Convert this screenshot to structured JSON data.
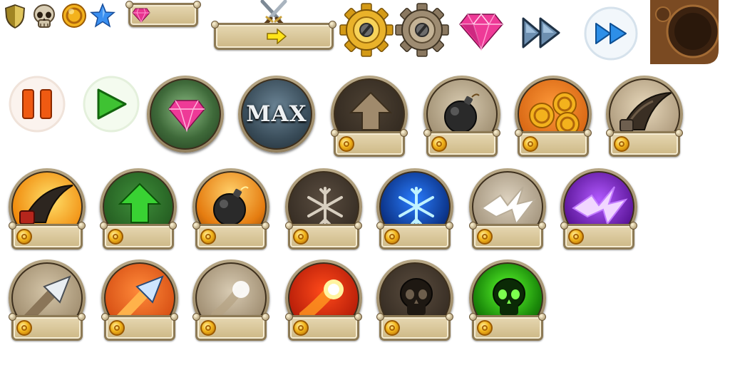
{
  "sheet": {
    "top_row": {
      "shield_icon": "shield-icon",
      "skull_icon": "skull-icon",
      "coin_icon": "coin-icon",
      "star_icon": "star-icon",
      "gem_plate_icon": "gem-icon",
      "battle_plate_icon": "crossed-swords-icon",
      "gold_gear_icon": "gear-icon",
      "steel_gear_icon": "gear-icon",
      "big_gem_icon": "gem-icon",
      "dark_fastforward_icon": "fast-forward-icon",
      "light_fastforward_icon": "fast-forward-icon",
      "panel_fragment": "bronze-panel"
    },
    "second_row": {
      "pause_icon": "pause-icon",
      "play_icon": "play-icon",
      "gem_medal_icon": "gem-icon",
      "max_badge": {
        "label": "MAX"
      },
      "upgrade_arrow_icon": "arrow-up-icon",
      "bomb_icon": "bomb-icon",
      "coins_icon": "coins-icon",
      "claw_icon": "claw-icon"
    },
    "third_row": [
      "claw-icon",
      "arrow-up-icon",
      "bomb-icon",
      "snowflake-icon",
      "snowflake-icon",
      "lightning-icon",
      "lightning-icon"
    ],
    "fourth_row": [
      "arrowhead-icon",
      "arrowhead-icon",
      "orb-icon",
      "fireball-icon",
      "skull-icon",
      "skull-icon"
    ]
  },
  "colors": {
    "gold": "#f2b51c",
    "plate": "#d8c69a",
    "plate_border": "#8d7a55",
    "green": "#2aa836",
    "blue": "#1f6fd1",
    "purple": "#9b3ad8",
    "fire": "#ff6a12"
  }
}
